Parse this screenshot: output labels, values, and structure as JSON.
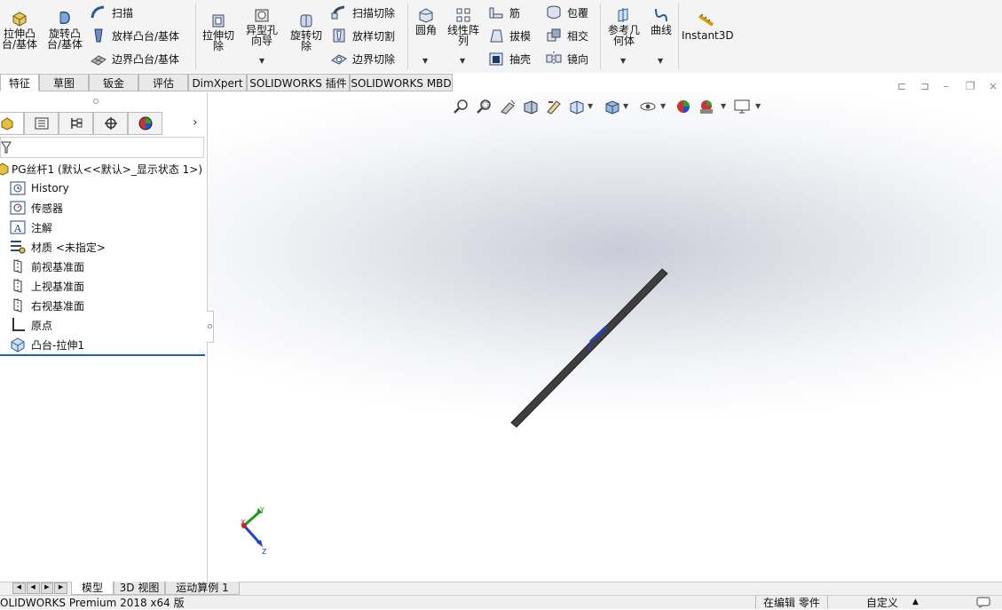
{
  "ribbon": {
    "extrude_boss": "拉伸凸\n台/基体",
    "revolve_boss": "旋转凸\n台/基体",
    "sweep": "扫描",
    "loft_boss": "放样凸台/基体",
    "boundary_boss": "边界凸台/基体",
    "extrude_cut": "拉伸切\n除",
    "hole_wizard": "异型孔\n向导",
    "revolve_cut": "旋转切\n除",
    "swept_cut": "扫描切除",
    "lofted_cut": "放样切割",
    "boundary_cut": "边界切除",
    "fillet": "圆角",
    "linear_pattern": "线性阵\n列",
    "rib": "筋",
    "draft": "拔模",
    "shell": "抽壳",
    "wrap": "包覆",
    "intersect": "相交",
    "mirror": "镜向",
    "ref_geometry": "参考几\n何体",
    "curves": "曲线",
    "instant3d": "Instant3D"
  },
  "tabs": [
    "特征",
    "草图",
    "钣金",
    "评估",
    "DimXpert",
    "SOLIDWORKS 插件",
    "SOLIDWORKS MBD"
  ],
  "tree": {
    "root": "PG丝杆1 (默认<<默认>_显示状态 1>)",
    "items": [
      "History",
      "传感器",
      "注解",
      "材质 <未指定>",
      "前视基准面",
      "上视基准面",
      "右视基准面",
      "原点",
      "凸台-拉伸1"
    ]
  },
  "bottom_tabs": [
    "模型",
    "3D 视图",
    "运动算例 1"
  ],
  "status": {
    "left": "OLIDWORKS Premium 2018 x64 版",
    "editing": "在编辑 零件",
    "custom": "自定义"
  },
  "triad": {
    "x": "X",
    "y": "Y",
    "z": "Z"
  },
  "colors": {
    "accent": "#1f5fbf",
    "rod": "#4a4a4a",
    "triad_x": "#d02020",
    "triad_y": "#1a9a1a",
    "triad_z": "#2040d0"
  }
}
